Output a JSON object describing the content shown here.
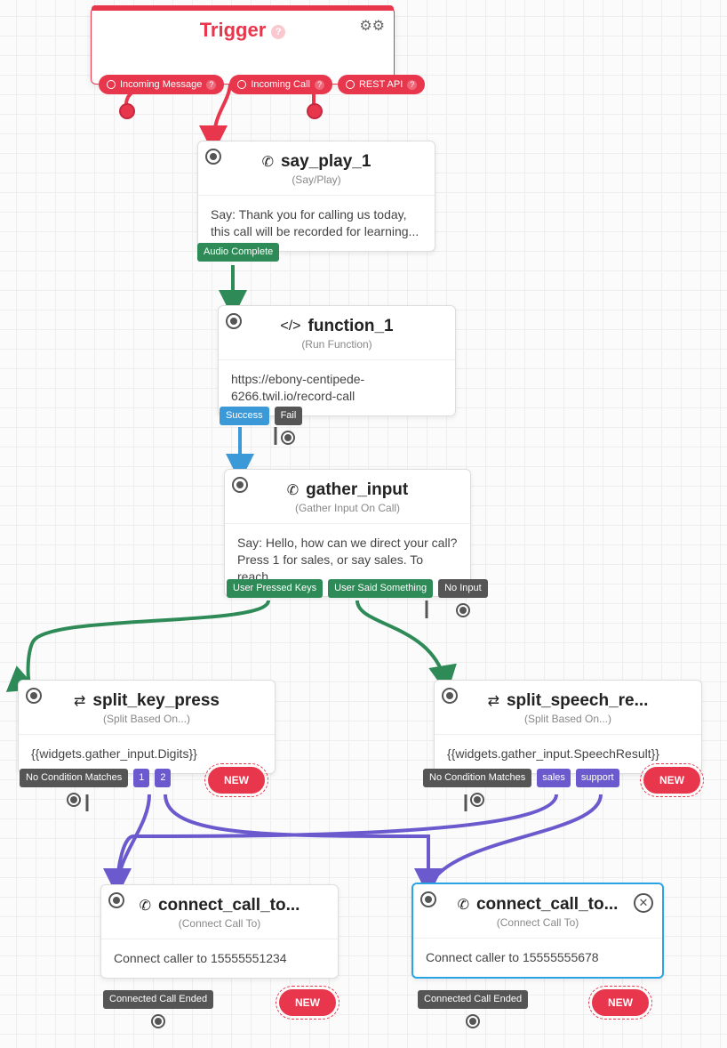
{
  "trigger": {
    "title": "Trigger",
    "pills": [
      "Incoming Message",
      "Incoming Call",
      "REST API"
    ]
  },
  "say_play": {
    "title": "say_play_1",
    "subtitle": "(Say/Play)",
    "body": "Say: Thank you for calling us today, this call will be recorded for learning...",
    "tag": "Audio Complete"
  },
  "function": {
    "title": "function_1",
    "subtitle": "(Run Function)",
    "body": "https://ebony-centipede-6266.twil.io/record-call",
    "tags": [
      "Success",
      "Fail"
    ]
  },
  "gather": {
    "title": "gather_input",
    "subtitle": "(Gather Input On Call)",
    "body": "Say: Hello, how can we direct your call? Press 1 for sales, or say sales. To reach...",
    "tags": [
      "User Pressed Keys",
      "User Said Something",
      "No Input"
    ]
  },
  "split_key": {
    "title": "split_key_press",
    "subtitle": "(Split Based On...)",
    "body": "{{widgets.gather_input.Digits}}",
    "tags": [
      "No Condition Matches",
      "1",
      "2"
    ],
    "new": "NEW"
  },
  "split_speech": {
    "title": "split_speech_re...",
    "subtitle": "(Split Based On...)",
    "body": "{{widgets.gather_input.SpeechResult}}",
    "tags": [
      "No Condition Matches",
      "sales",
      "support"
    ],
    "new": "NEW"
  },
  "connect1": {
    "title": "connect_call_to...",
    "subtitle": "(Connect Call To)",
    "body": "Connect caller to 15555551234",
    "tag": "Connected Call Ended",
    "new": "NEW"
  },
  "connect2": {
    "title": "connect_call_to...",
    "subtitle": "(Connect Call To)",
    "body": "Connect caller to 15555555678",
    "tag": "Connected Call Ended",
    "new": "NEW"
  },
  "chart_data": {
    "type": "flow",
    "nodes": [
      {
        "id": "trigger",
        "type": "Trigger",
        "outputs": [
          "Incoming Message",
          "Incoming Call",
          "REST API"
        ]
      },
      {
        "id": "say_play_1",
        "type": "Say/Play",
        "text": "Thank you for calling us today, this call will be recorded for learning...",
        "outputs": [
          "Audio Complete"
        ]
      },
      {
        "id": "function_1",
        "type": "Run Function",
        "url": "https://ebony-centipede-6266.twil.io/record-call",
        "outputs": [
          "Success",
          "Fail"
        ]
      },
      {
        "id": "gather_input",
        "type": "Gather Input On Call",
        "text": "Hello, how can we direct your call? Press 1 for sales, or say sales. To reach...",
        "outputs": [
          "User Pressed Keys",
          "User Said Something",
          "No Input"
        ]
      },
      {
        "id": "split_key_press",
        "type": "Split Based On",
        "input": "{{widgets.gather_input.Digits}}",
        "outputs": [
          "No Condition Matches",
          "1",
          "2",
          "NEW"
        ]
      },
      {
        "id": "split_speech_result",
        "type": "Split Based On",
        "input": "{{widgets.gather_input.SpeechResult}}",
        "outputs": [
          "No Condition Matches",
          "sales",
          "support",
          "NEW"
        ]
      },
      {
        "id": "connect_call_to_1",
        "type": "Connect Call To",
        "target": "15555551234",
        "outputs": [
          "Connected Call Ended",
          "NEW"
        ]
      },
      {
        "id": "connect_call_to_2",
        "type": "Connect Call To",
        "target": "15555555678",
        "outputs": [
          "Connected Call Ended",
          "NEW"
        ]
      }
    ],
    "edges": [
      {
        "from": "trigger",
        "output": "Incoming Call",
        "to": "say_play_1",
        "color": "#e8364c"
      },
      {
        "from": "say_play_1",
        "output": "Audio Complete",
        "to": "function_1",
        "color": "#2e8b57"
      },
      {
        "from": "function_1",
        "output": "Success",
        "to": "gather_input",
        "color": "#3b99d8"
      },
      {
        "from": "gather_input",
        "output": "User Pressed Keys",
        "to": "split_key_press",
        "color": "#2e8b57"
      },
      {
        "from": "gather_input",
        "output": "User Said Something",
        "to": "split_speech_result",
        "color": "#2e8b57"
      },
      {
        "from": "split_key_press",
        "output": "1",
        "to": "connect_call_to_1",
        "color": "#6a5acd"
      },
      {
        "from": "split_key_press",
        "output": "2",
        "to": "connect_call_to_2",
        "color": "#6a5acd"
      },
      {
        "from": "split_speech_result",
        "output": "sales",
        "to": "connect_call_to_1",
        "color": "#6a5acd"
      },
      {
        "from": "split_speech_result",
        "output": "support",
        "to": "connect_call_to_2",
        "color": "#6a5acd"
      }
    ]
  }
}
